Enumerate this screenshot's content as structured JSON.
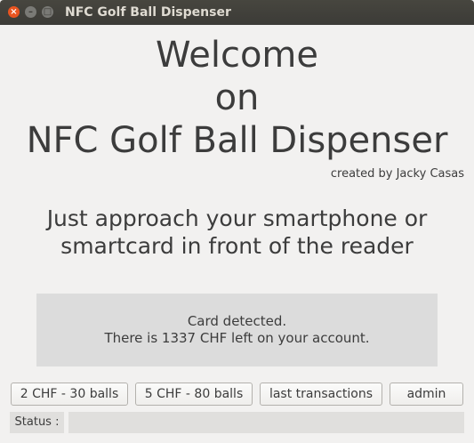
{
  "window": {
    "title": "NFC Golf Ball Dispenser",
    "close_glyph": "×",
    "min_glyph": "–",
    "max_glyph": "□"
  },
  "header": {
    "line1": "Welcome",
    "line2": "on",
    "line3": "NFC Golf Ball Dispenser",
    "credit": "created by Jacky Casas"
  },
  "instruction": {
    "line1": "Just approach your smartphone or",
    "line2": "smartcard in front of the reader"
  },
  "message": {
    "line1": "Card detected.",
    "line2": "There is 1337 CHF left on your account."
  },
  "buttons": {
    "option1": "2 CHF - 30 balls",
    "option2": "5 CHF - 80 balls",
    "transactions": "last transactions",
    "admin": "admin"
  },
  "status": {
    "label": "Status :",
    "value": ""
  }
}
